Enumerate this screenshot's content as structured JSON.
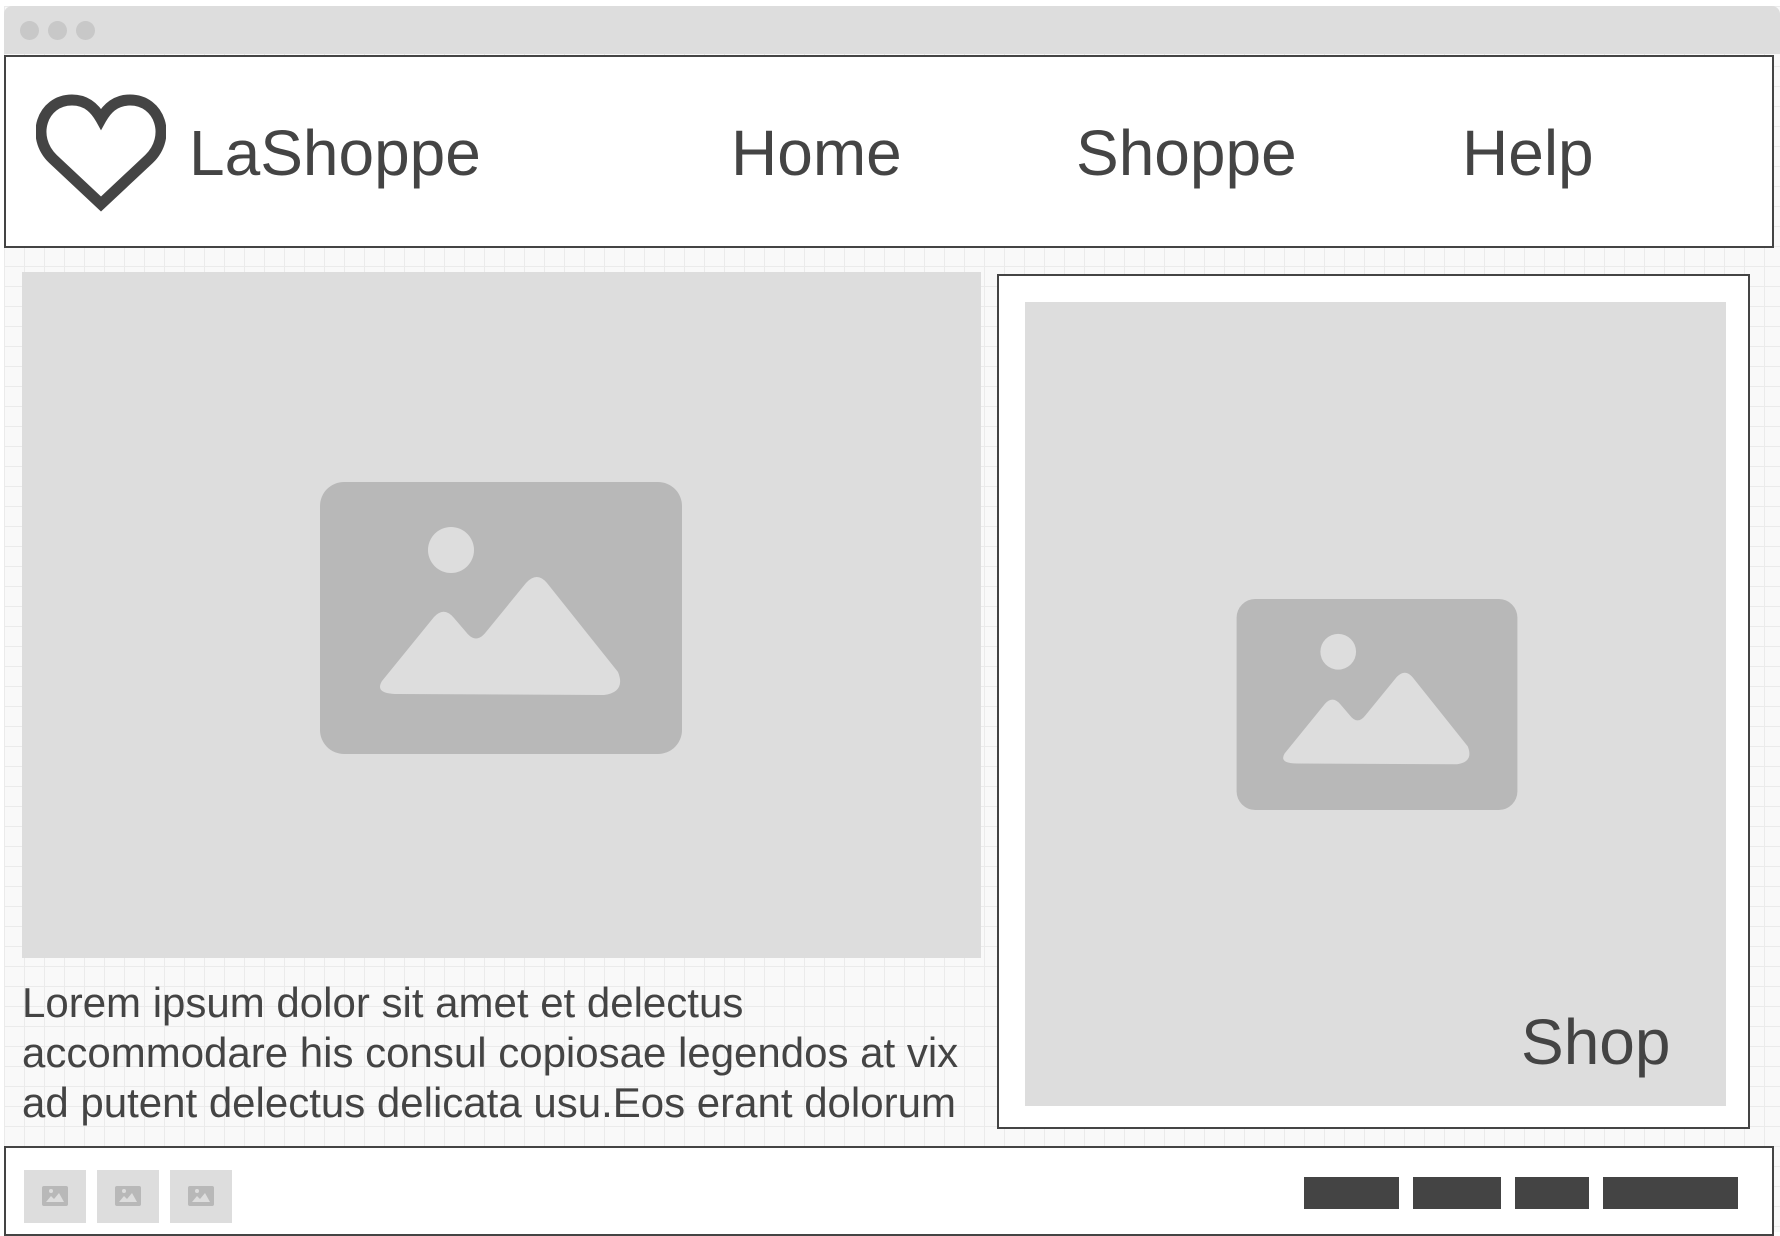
{
  "header": {
    "brand": "LaShoppe",
    "nav": [
      {
        "label": "Home"
      },
      {
        "label": "Shoppe"
      },
      {
        "label": "Help"
      }
    ]
  },
  "main": {
    "body_lines": [
      "Lorem ipsum dolor sit amet et delectus",
      "accommodare his consul copiosae legendos at vix",
      "ad putent delectus delicata usu.Eos erant dolorum"
    ]
  },
  "promo": {
    "label": "Shop"
  },
  "icons": {
    "logo": "heart-icon",
    "image_placeholder": "image-placeholder-icon"
  },
  "colors": {
    "ink": "#444444",
    "placeholder": "#dddddd",
    "placeholder_icon": "#b8b8b8"
  }
}
